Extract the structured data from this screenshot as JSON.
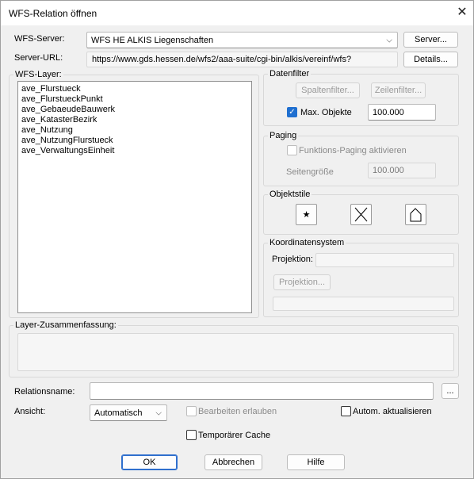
{
  "window": {
    "title": "WFS-Relation öffnen"
  },
  "icons": {
    "close": "close-icon",
    "chevron": "chevron-down-icon",
    "star": "star-icon",
    "cross": "cross-icon",
    "house": "house-icon",
    "check": "checkmark-icon"
  },
  "server": {
    "label": "WFS-Server:",
    "value": "WFS HE ALKIS Liegenschaften",
    "button": "Server...",
    "url_label": "Server-URL:",
    "url_value": "https://www.gds.hessen.de/wfs2/aaa-suite/cgi-bin/alkis/vereinf/wfs?",
    "details_button": "Details..."
  },
  "layers": {
    "label": "WFS-Layer:",
    "items": [
      "ave_Flurstueck",
      "ave_FlurstueckPunkt",
      "ave_GebaeudeBauwerk",
      "ave_KatasterBezirk",
      "ave_Nutzung",
      "ave_NutzungFlurstueck",
      "ave_VerwaltungsEinheit"
    ]
  },
  "datenfilter": {
    "title": "Datenfilter",
    "spaltenfilter": "Spaltenfilter...",
    "zeilenfilter": "Zeilenfilter...",
    "max_label": "Max. Objekte",
    "max_checked": true,
    "max_value": "100.000"
  },
  "paging": {
    "title": "Paging",
    "checkbox": "Funktions-Paging aktivieren",
    "checked": false,
    "page_size_label": "Seitengröße",
    "page_size_value": "100.000"
  },
  "objektstile": {
    "title": "Objektstile",
    "star_glyph": "★"
  },
  "koordinaten": {
    "title": "Koordinatensystem",
    "projektion_label": "Projektion:",
    "projektion_value": "",
    "projektion_button": "Projektion...",
    "extra_value": ""
  },
  "summary": {
    "label": "Layer-Zusammenfassung:",
    "value": ""
  },
  "relation": {
    "label": "Relationsname:",
    "value": "",
    "browse": "..."
  },
  "ansicht": {
    "label": "Ansicht:",
    "value": "Automatisch",
    "bearbeiten": "Bearbeiten erlauben",
    "bearbeiten_checked": false,
    "autom": "Autom. aktualisieren",
    "autom_checked": false,
    "cache": "Temporärer Cache",
    "cache_checked": false
  },
  "buttons": {
    "ok": "OK",
    "cancel": "Abbrechen",
    "help": "Hilfe"
  }
}
